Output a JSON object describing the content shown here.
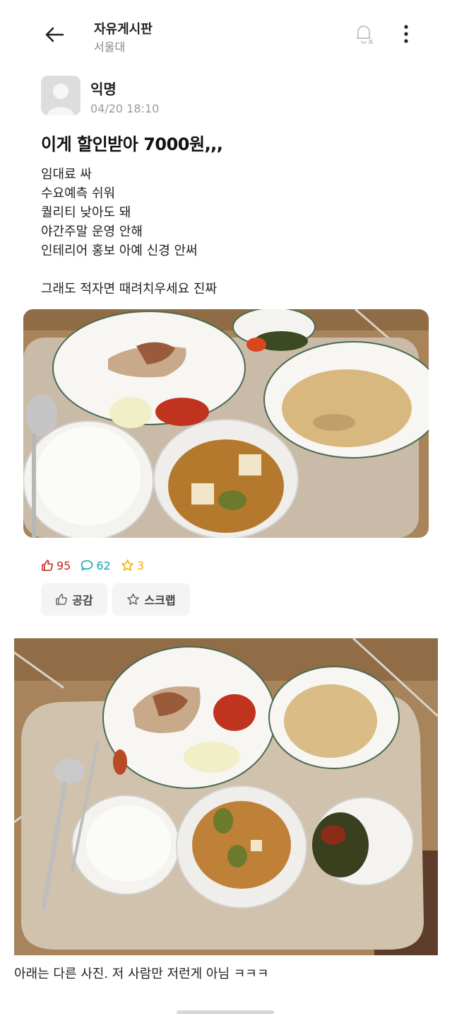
{
  "header": {
    "board_title": "자유게시판",
    "board_subtitle": "서울대",
    "icons": [
      "back-arrow-icon",
      "notification-off-icon",
      "more-vertical-icon"
    ]
  },
  "post": {
    "author": "익명",
    "date": "04/20 18:10",
    "title": "이게 할인받아 7000원,,,",
    "body_lines": [
      "임대료 싸",
      "수요예측 쉬워",
      "퀄리티 낮아도 돼",
      "야간주말 운영 안해",
      "인테리어 홍보 아예 신경 안써",
      "",
      "그래도 적자면 때려치우세요 진짜"
    ],
    "stats": {
      "likes": "95",
      "comments": "62",
      "scraps": "3"
    },
    "buttons": {
      "like_label": "공감",
      "scrap_label": "스크랩"
    }
  },
  "caption": "아래는 다른 사진. 저 사람만 저런게 아님 ㅋㅋㅋ",
  "colors": {
    "like": "#c62917",
    "comment": "#0ca5af",
    "scrap": "#f2b100",
    "tray": "#cbbfae",
    "table": "#b08a5e"
  }
}
